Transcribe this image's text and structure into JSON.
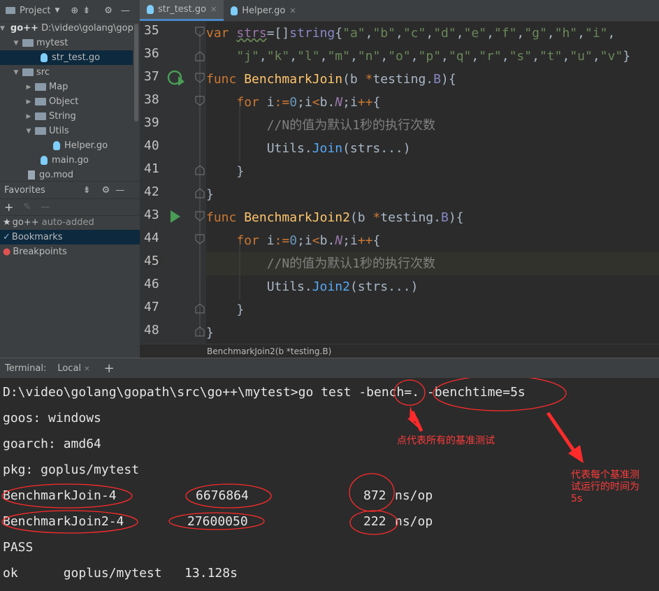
{
  "sidebar": {
    "header_label": "Project",
    "tree": [
      {
        "label": "go++",
        "sub": "D:\\video\\golang\\gop"
      },
      {
        "label": "mytest"
      },
      {
        "label": "str_test.go"
      },
      {
        "label": "src"
      },
      {
        "label": "Map"
      },
      {
        "label": "Object"
      },
      {
        "label": "String"
      },
      {
        "label": "Utils"
      },
      {
        "label": "Helper.go"
      },
      {
        "label": "main.go"
      },
      {
        "label": "go.mod"
      }
    ],
    "favorites_label": "Favorites",
    "favorites": [
      {
        "label": "go++",
        "sub": "auto-added"
      },
      {
        "label": "Bookmarks"
      },
      {
        "label": "Breakpoints"
      }
    ]
  },
  "tabs": [
    {
      "label": "str_test.go"
    },
    {
      "label": "Helper.go"
    }
  ],
  "editor": {
    "line_numbers": [
      "35",
      "36",
      "37",
      "38",
      "39",
      "40",
      "41",
      "42",
      "43",
      "44",
      "45",
      "46",
      "47",
      "48"
    ],
    "comment_text": "//N的值为默认1秒的执行次数",
    "breadcrumb": "BenchmarkJoin2(b *testing.B)"
  },
  "terminal": {
    "title": "Terminal:",
    "tab_label": "Local",
    "lines": [
      "D:\\video\\golang\\gopath\\src\\go++\\mytest>go test -bench=. -benchtime=5s",
      "goos: windows",
      "goarch: amd64",
      "pkg: goplus/mytest",
      "BenchmarkJoin-4",
      "BenchmarkJoin2-4",
      "PASS",
      "ok      goplus/mytest   13.128s"
    ],
    "results": [
      {
        "n": "6676864",
        "ns": "872",
        "unit": "ns/op"
      },
      {
        "n": "27600050",
        "ns": "222",
        "unit": "ns/op"
      }
    ]
  },
  "annotations": {
    "dot_note": "点代表所有的基准测试",
    "time_note_1": "代表每个基准测",
    "time_note_2": "试运行的时间为",
    "time_note_3": "5s",
    "color": "#ff2b2b"
  }
}
